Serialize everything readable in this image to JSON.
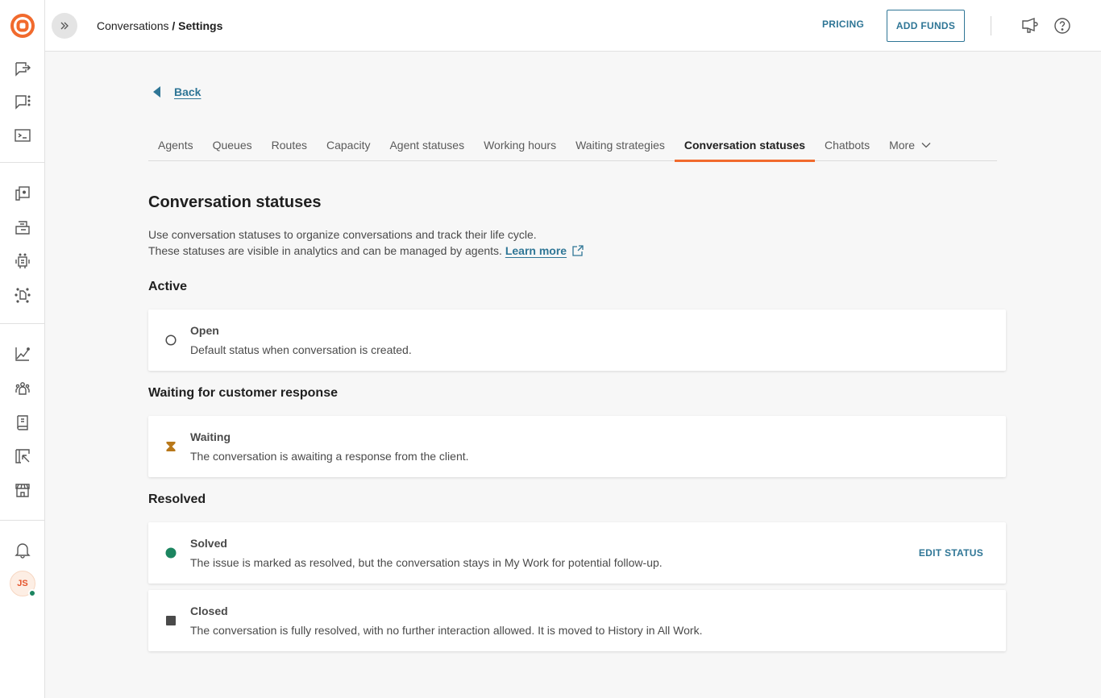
{
  "rail": {
    "avatar_initials": "JS",
    "items_top": [
      "outbound-conversation-icon",
      "conversation-menu-icon",
      "terminal-icon"
    ],
    "items_mid": [
      "knowledge-icon",
      "inbox-icon",
      "bot-icon",
      "integrations-icon"
    ],
    "items_low": [
      "analytics-icon",
      "people-icon",
      "contacts-book-icon",
      "campaigns-icon",
      "store-icon"
    ],
    "items_bottom": [
      "notifications-icon"
    ]
  },
  "topbar": {
    "breadcrumb_parent": "Conversations",
    "breadcrumb_separator": " / ",
    "breadcrumb_current": "Settings",
    "pricing_label": "PRICING",
    "add_funds_label": "ADD FUNDS"
  },
  "main": {
    "back_label": "Back",
    "tabs": [
      {
        "label": "Agents",
        "active": false
      },
      {
        "label": "Queues",
        "active": false
      },
      {
        "label": "Routes",
        "active": false
      },
      {
        "label": "Capacity",
        "active": false
      },
      {
        "label": "Agent statuses",
        "active": false
      },
      {
        "label": "Working hours",
        "active": false
      },
      {
        "label": "Waiting strategies",
        "active": false
      },
      {
        "label": "Conversation statuses",
        "active": true
      },
      {
        "label": "Chatbots",
        "active": false
      },
      {
        "label": "More",
        "active": false
      }
    ],
    "title": "Conversation statuses",
    "description_line1": "Use conversation statuses to organize conversations and track their life cycle.",
    "description_line2": "These statuses are visible in analytics and can be managed by agents.",
    "learn_more_label": "Learn more",
    "sections": [
      {
        "title": "Active",
        "statuses": [
          {
            "name": "Open",
            "description": "Default status when conversation is created.",
            "icon": "circle-outline-icon",
            "color": "#4a4a4a"
          }
        ]
      },
      {
        "title": "Waiting for customer response",
        "statuses": [
          {
            "name": "Waiting",
            "description": "The conversation is awaiting a response from the client.",
            "icon": "hourglass-icon",
            "color": "#b8781a"
          }
        ]
      },
      {
        "title": "Resolved",
        "statuses": [
          {
            "name": "Solved",
            "description": "The issue is marked as resolved, but the conversation stays in My Work for potential follow-up.",
            "icon": "filled-circle-icon",
            "color": "#1c8560",
            "action_label": "EDIT STATUS"
          },
          {
            "name": "Closed",
            "description": "The conversation is fully resolved, with no further interaction allowed. It is moved to History in All Work.",
            "icon": "filled-square-icon",
            "color": "#4a4a4a"
          }
        ]
      }
    ]
  },
  "colors": {
    "brand_orange": "#f16a2d",
    "link_blue": "#2f7696",
    "success_green": "#1c8560",
    "waiting_amber": "#b8781a"
  }
}
